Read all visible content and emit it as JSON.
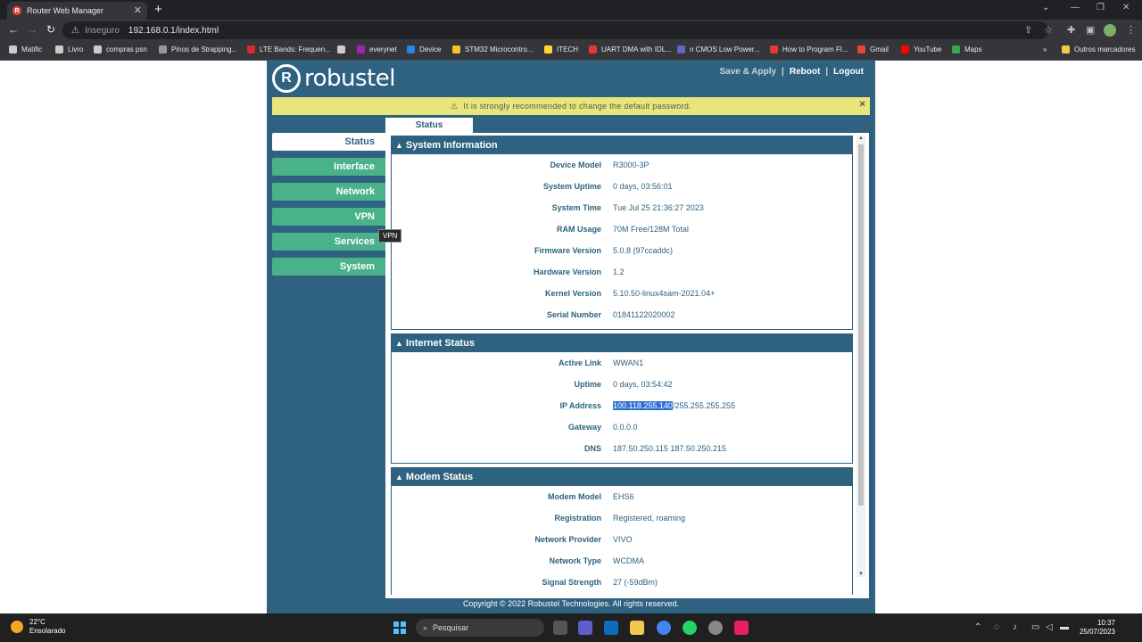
{
  "browser": {
    "tab_title": "Router Web Manager",
    "address_security": "Inseguro",
    "url": "192.168.0.1/index.html",
    "bookmarks": [
      {
        "label": "Matific",
        "color": "#cccccc"
      },
      {
        "label": "Livro",
        "color": "#cccccc"
      },
      {
        "label": "compras psn",
        "color": "#cccccc"
      },
      {
        "label": "Pinos de Strapping...",
        "color": "#999999"
      },
      {
        "label": "LTE Bands: Frequen...",
        "color": "#d32f2f"
      },
      {
        "label": "",
        "color": "#cccccc"
      },
      {
        "label": "everynet",
        "color": "#9c27b0"
      },
      {
        "label": "Device",
        "color": "#1e88e5"
      },
      {
        "label": "STM32 Microcontro...",
        "color": "#fbc02d"
      },
      {
        "label": "ITECH",
        "color": "#fdd835"
      },
      {
        "label": "UART DMA with IDL...",
        "color": "#e53935"
      },
      {
        "label": "n CMOS Low Power...",
        "color": "#5c6bc0"
      },
      {
        "label": "How to Program Fl...",
        "color": "#e53935"
      },
      {
        "label": "Gmail",
        "color": "#ea4335"
      },
      {
        "label": "YouTube",
        "color": "#ff0000"
      },
      {
        "label": "Maps",
        "color": "#34a853"
      }
    ],
    "other_bookmarks": "Outros marcadores"
  },
  "router": {
    "logo_text": "robustel",
    "nav": {
      "save_apply": "Save & Apply",
      "reboot": "Reboot",
      "logout": "Logout"
    },
    "warning": "It is strongly recommended to change the default password.",
    "sidebar": [
      {
        "label": "Status",
        "active": true
      },
      {
        "label": "Interface",
        "active": false
      },
      {
        "label": "Network",
        "active": false
      },
      {
        "label": "VPN",
        "active": false
      },
      {
        "label": "Services",
        "active": false
      },
      {
        "label": "System",
        "active": false
      }
    ],
    "tooltip": "VPN",
    "content_tab": "Status",
    "sections": {
      "system": {
        "title": "System Information",
        "rows": [
          {
            "label": "Device Model",
            "value": "R3000-3P"
          },
          {
            "label": "System Uptime",
            "value": "0 days, 03:56:01"
          },
          {
            "label": "System Time",
            "value": "Tue Jul 25 21:36:27 2023"
          },
          {
            "label": "RAM Usage",
            "value": "70M Free/128M Total"
          },
          {
            "label": "Firmware Version",
            "value": "5.0.8 (97ccaddc)"
          },
          {
            "label": "Hardware Version",
            "value": "1.2"
          },
          {
            "label": "Kernel Version",
            "value": "5.10.50-linux4sam-2021.04+"
          },
          {
            "label": "Serial Number",
            "value": "01841122020002"
          }
        ]
      },
      "internet": {
        "title": "Internet Status",
        "active_link_label": "Active Link",
        "active_link": "WWAN1",
        "uptime_label": "Uptime",
        "uptime": "0 days, 03:54:42",
        "ip_label": "IP Address",
        "ip_selected": "100.118.255.140",
        "ip_rest": "/255.255.255.255",
        "gateway_label": "Gateway",
        "gateway": "0.0.0.0",
        "dns_label": "DNS",
        "dns": "187.50.250.115 187.50.250.215"
      },
      "modem": {
        "title": "Modem Status",
        "rows": [
          {
            "label": "Modem Model",
            "value": "EHS6"
          },
          {
            "label": "Registration",
            "value": "Registered, roaming"
          },
          {
            "label": "Network Provider",
            "value": "VIVO"
          },
          {
            "label": "Network Type",
            "value": "WCDMA"
          },
          {
            "label": "Signal Strength",
            "value": "27 (-59dBm)"
          }
        ]
      }
    },
    "footer": "Copyright © 2022 Robustel Technologies. All rights reserved."
  },
  "taskbar": {
    "temperature": "22°C",
    "weather": "Ensolarado",
    "search": "Pesquisar",
    "time": "10:37",
    "date": "25/07/2023"
  },
  "colors": {
    "router_bg": "#2e6280",
    "sidebar_item": "#4ab28a",
    "warning_bg": "#e8e67a",
    "selection": "#2f70d4"
  }
}
